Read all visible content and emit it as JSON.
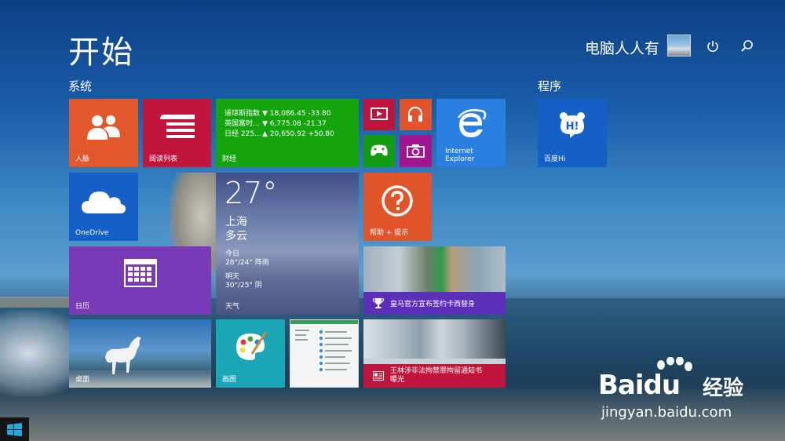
{
  "screen": {
    "title": "开始",
    "user_name": "电脑人人有",
    "power_icon": "power-icon",
    "search_icon": "search-icon"
  },
  "groups": {
    "system": "系统",
    "programs": "程序"
  },
  "tiles": {
    "people": {
      "label": "人脉",
      "color": "#e3582b",
      "icon": "people-icon"
    },
    "reading_list": {
      "label": "阅读列表",
      "color": "#c1163c",
      "icon": "reading-list-icon"
    },
    "finance": {
      "label": "财经",
      "color": "#13a40e",
      "rows": [
        {
          "name": "道琼斯指数",
          "value": "▼ 18,086.45 -33.80"
        },
        {
          "name": "英国富时...",
          "value": "▼ 6,775.08 -21.37"
        },
        {
          "name": "日经 225...",
          "value": "▲ 20,650.92 +50.80"
        }
      ]
    },
    "video": {
      "color": "#c0153b",
      "icon": "video-icon"
    },
    "music": {
      "color": "#e0542b",
      "icon": "headphones-icon"
    },
    "games": {
      "color": "#129d0f",
      "icon": "xbox-controller-icon"
    },
    "camera": {
      "color": "#a1168f",
      "icon": "camera-icon"
    },
    "ie": {
      "label_line1": "Internet",
      "label_line2": "Explorer",
      "color": "#2a7fe0",
      "icon": "internet-explorer-icon"
    },
    "baidu_hi": {
      "label": "百度Hi",
      "color": "#1460c8",
      "icon": "baidu-hi-icon"
    },
    "onedrive": {
      "label": "OneDrive",
      "color": "#1460c8",
      "icon": "cloud-icon"
    },
    "weather": {
      "label": "天气",
      "temp": "27°",
      "city": "上海",
      "condition": "多云",
      "today_label": "今日",
      "today_forecast": "28°/24° 阵雨",
      "tomorrow_label": "明天",
      "tomorrow_forecast": "30°/25° 阴"
    },
    "help": {
      "label": "帮助 + 提示",
      "color": "#e0542b",
      "icon": "question-icon"
    },
    "calendar": {
      "label": "日历",
      "color": "#7a3ab6",
      "icon": "calendar-icon"
    },
    "sports": {
      "headline": "皇马官方宣布签约卡西替身",
      "bar_color": "#5c2fb8",
      "icon": "trophy-icon"
    },
    "desktop": {
      "label": "桌面"
    },
    "paint": {
      "label": "画图",
      "color": "#1aa6b5",
      "icon": "palette-icon"
    },
    "news": {
      "headline_line1": "王林涉非法拘禁罪拘留通知书",
      "headline_line2": "曝光",
      "bar_color": "#c1163c",
      "icon": "news-icon"
    }
  },
  "watermark": {
    "brand_text": "Bai",
    "brand_text2": "du",
    "brand_cn": "经验",
    "url": "jingyan.baidu.com"
  },
  "taskbar": {
    "start_icon": "windows-logo-icon"
  }
}
